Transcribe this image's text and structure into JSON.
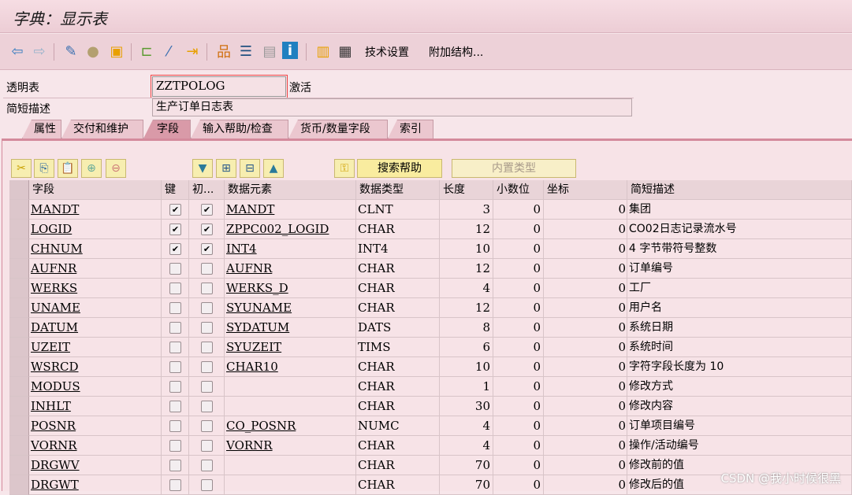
{
  "title": "字典：显示表",
  "toolbar": {
    "icons": [
      "back-icon",
      "forward-icon",
      "display-change-icon",
      "other-object-icon",
      "activate-icon",
      "where-used-icon",
      "magic-wand-icon",
      "navigate-icon",
      "hierarchy-icon",
      "object-list-icon",
      "layout-icon",
      "info-icon",
      "fields-icon",
      "columns-icon"
    ],
    "tech_settings": "技术设置",
    "append_structure": "附加结构..."
  },
  "form": {
    "table_label": "透明表",
    "table_value": "ZZTPOLOG",
    "status": "激活",
    "desc_label": "简短描述",
    "desc_value": "生产订单日志表"
  },
  "tabs": [
    "属性",
    "交付和维护",
    "字段",
    "输入帮助/检查",
    "货币/数量字段",
    "索引"
  ],
  "active_tab": "字段",
  "field_toolbar": {
    "search_help": "搜索帮助",
    "builtin_type": "内置类型"
  },
  "columns": [
    "字段",
    "键",
    "初...",
    "数据元素",
    "数据类型",
    "长度",
    "小数位",
    "坐标",
    "简短描述"
  ],
  "rows": [
    {
      "field": "MANDT",
      "key": true,
      "init": true,
      "element": "MANDT",
      "type": "CLNT",
      "len": "3",
      "dec": "0",
      "coord": "0",
      "desc": "集团"
    },
    {
      "field": "LOGID",
      "key": true,
      "init": true,
      "element": "ZPPC002_LOGID",
      "type": "CHAR",
      "len": "12",
      "dec": "0",
      "coord": "0",
      "desc": "CO02日志记录流水号"
    },
    {
      "field": "CHNUM",
      "key": true,
      "init": true,
      "element": "INT4",
      "type": "INT4",
      "len": "10",
      "dec": "0",
      "coord": "0",
      "desc": "4 字节带符号整数"
    },
    {
      "field": "AUFNR",
      "key": false,
      "init": false,
      "element": "AUFNR",
      "type": "CHAR",
      "len": "12",
      "dec": "0",
      "coord": "0",
      "desc": "订单编号"
    },
    {
      "field": "WERKS",
      "key": false,
      "init": false,
      "element": "WERKS_D",
      "type": "CHAR",
      "len": "4",
      "dec": "0",
      "coord": "0",
      "desc": "工厂"
    },
    {
      "field": "UNAME",
      "key": false,
      "init": false,
      "element": "SYUNAME",
      "type": "CHAR",
      "len": "12",
      "dec": "0",
      "coord": "0",
      "desc": "用户名"
    },
    {
      "field": "DATUM",
      "key": false,
      "init": false,
      "element": "SYDATUM",
      "type": "DATS",
      "len": "8",
      "dec": "0",
      "coord": "0",
      "desc": "系统日期"
    },
    {
      "field": "UZEIT",
      "key": false,
      "init": false,
      "element": "SYUZEIT",
      "type": "TIMS",
      "len": "6",
      "dec": "0",
      "coord": "0",
      "desc": "系统时间"
    },
    {
      "field": "WSRCD",
      "key": false,
      "init": false,
      "element": "CHAR10",
      "type": "CHAR",
      "len": "10",
      "dec": "0",
      "coord": "0",
      "desc": "字符字段长度为 10"
    },
    {
      "field": "MODUS",
      "key": false,
      "init": false,
      "element": "",
      "type": "CHAR",
      "len": "1",
      "dec": "0",
      "coord": "0",
      "desc": "修改方式"
    },
    {
      "field": "INHLT",
      "key": false,
      "init": false,
      "element": "",
      "type": "CHAR",
      "len": "30",
      "dec": "0",
      "coord": "0",
      "desc": "修改内容"
    },
    {
      "field": "POSNR",
      "key": false,
      "init": false,
      "element": "CO_POSNR",
      "type": "NUMC",
      "len": "4",
      "dec": "0",
      "coord": "0",
      "desc": "订单项目编号"
    },
    {
      "field": "VORNR",
      "key": false,
      "init": false,
      "element": "VORNR",
      "type": "CHAR",
      "len": "4",
      "dec": "0",
      "coord": "0",
      "desc": "操作/活动编号"
    },
    {
      "field": "DRGWV",
      "key": false,
      "init": false,
      "element": "",
      "type": "CHAR",
      "len": "70",
      "dec": "0",
      "coord": "0",
      "desc": "修改前的值"
    },
    {
      "field": "DRGWT",
      "key": false,
      "init": false,
      "element": "",
      "type": "CHAR",
      "len": "70",
      "dec": "0",
      "coord": "0",
      "desc": "修改后的值"
    }
  ],
  "watermark": "CSDN @我小时候很黑"
}
